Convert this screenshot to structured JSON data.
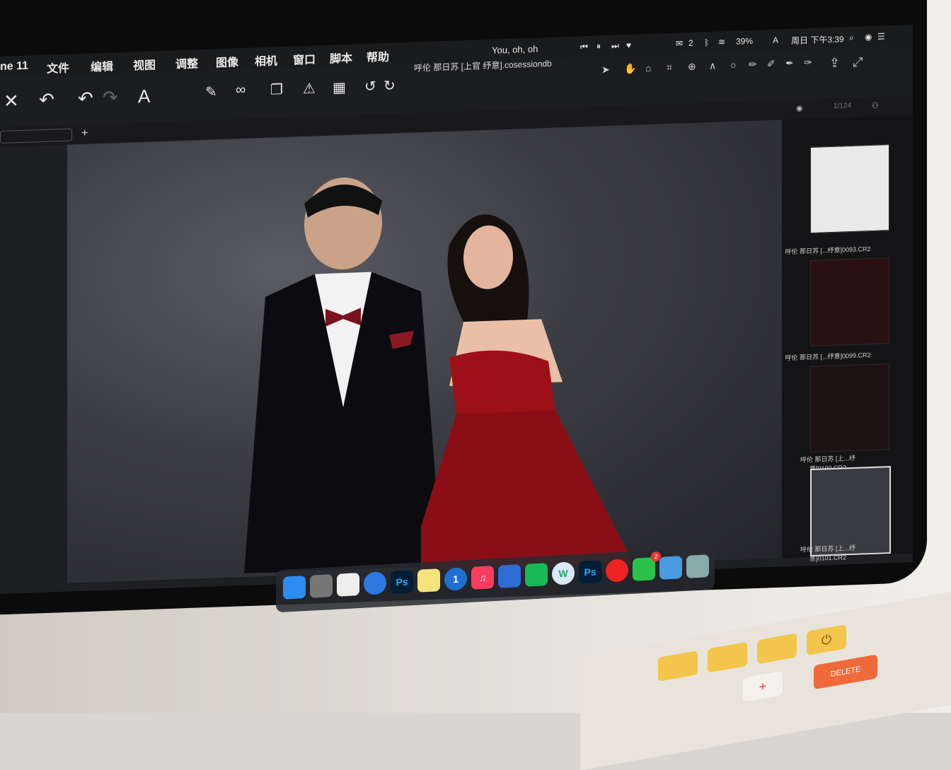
{
  "menubar": {
    "app_name": "ne 11",
    "menus": [
      "文件",
      "编辑",
      "视图",
      "调整",
      "图像",
      "相机",
      "窗口",
      "脚本",
      "帮助"
    ],
    "now_playing": "You, oh, oh",
    "battery": "39%",
    "input_method": "A",
    "clock": "周日 下午3:39",
    "wechat_count": "2"
  },
  "window": {
    "document_title": "呼伦 那日苏 [上官 纾意].cosessiondb"
  },
  "toolbar": {
    "left_icons": [
      "close-icon",
      "undo-all-icon",
      "undo-icon",
      "redo-icon",
      "text-icon",
      "edit-icon",
      "compare-icon",
      "stack-icon",
      "warning-icon",
      "grid-icon",
      "rotate-left-icon",
      "rotate-right-icon"
    ],
    "right_tools": [
      "cursor-tool",
      "hand-tool",
      "focus-tool",
      "crop-tool",
      "keystone-tool",
      "spot-tool",
      "circle-tool",
      "brush-tool",
      "eraser-tool",
      "gradient-tool",
      "picker-tool",
      "export-icon",
      "fullscreen-icon"
    ]
  },
  "browser": {
    "count": "1/124",
    "thumbnails": [
      {
        "label": "呼伦 那日苏 [...纾意]0093.CR2"
      },
      {
        "label": "呼伦 那日苏 [...纾意]0099.CR2"
      },
      {
        "label": "呼伦 那日苏 [上...纾意]0100.CR2"
      },
      {
        "label": "呼伦 那日苏 [上...纾意]0101.CR2"
      }
    ]
  },
  "dock": {
    "apps": [
      "Finder",
      "System Preferences",
      "Preview",
      "Safari",
      "Ps",
      "Notes",
      "1Password",
      "Music",
      "Keynote",
      "iQIYI",
      "Word",
      "Ps",
      "NetEase Music",
      "WeChat",
      "Cloud",
      "Preview",
      "Trash"
    ],
    "wechat_badge": "2"
  },
  "keyboard": {
    "keys": [
      "+",
      "-",
      "⏻"
    ],
    "delete_label": "DELETE"
  }
}
